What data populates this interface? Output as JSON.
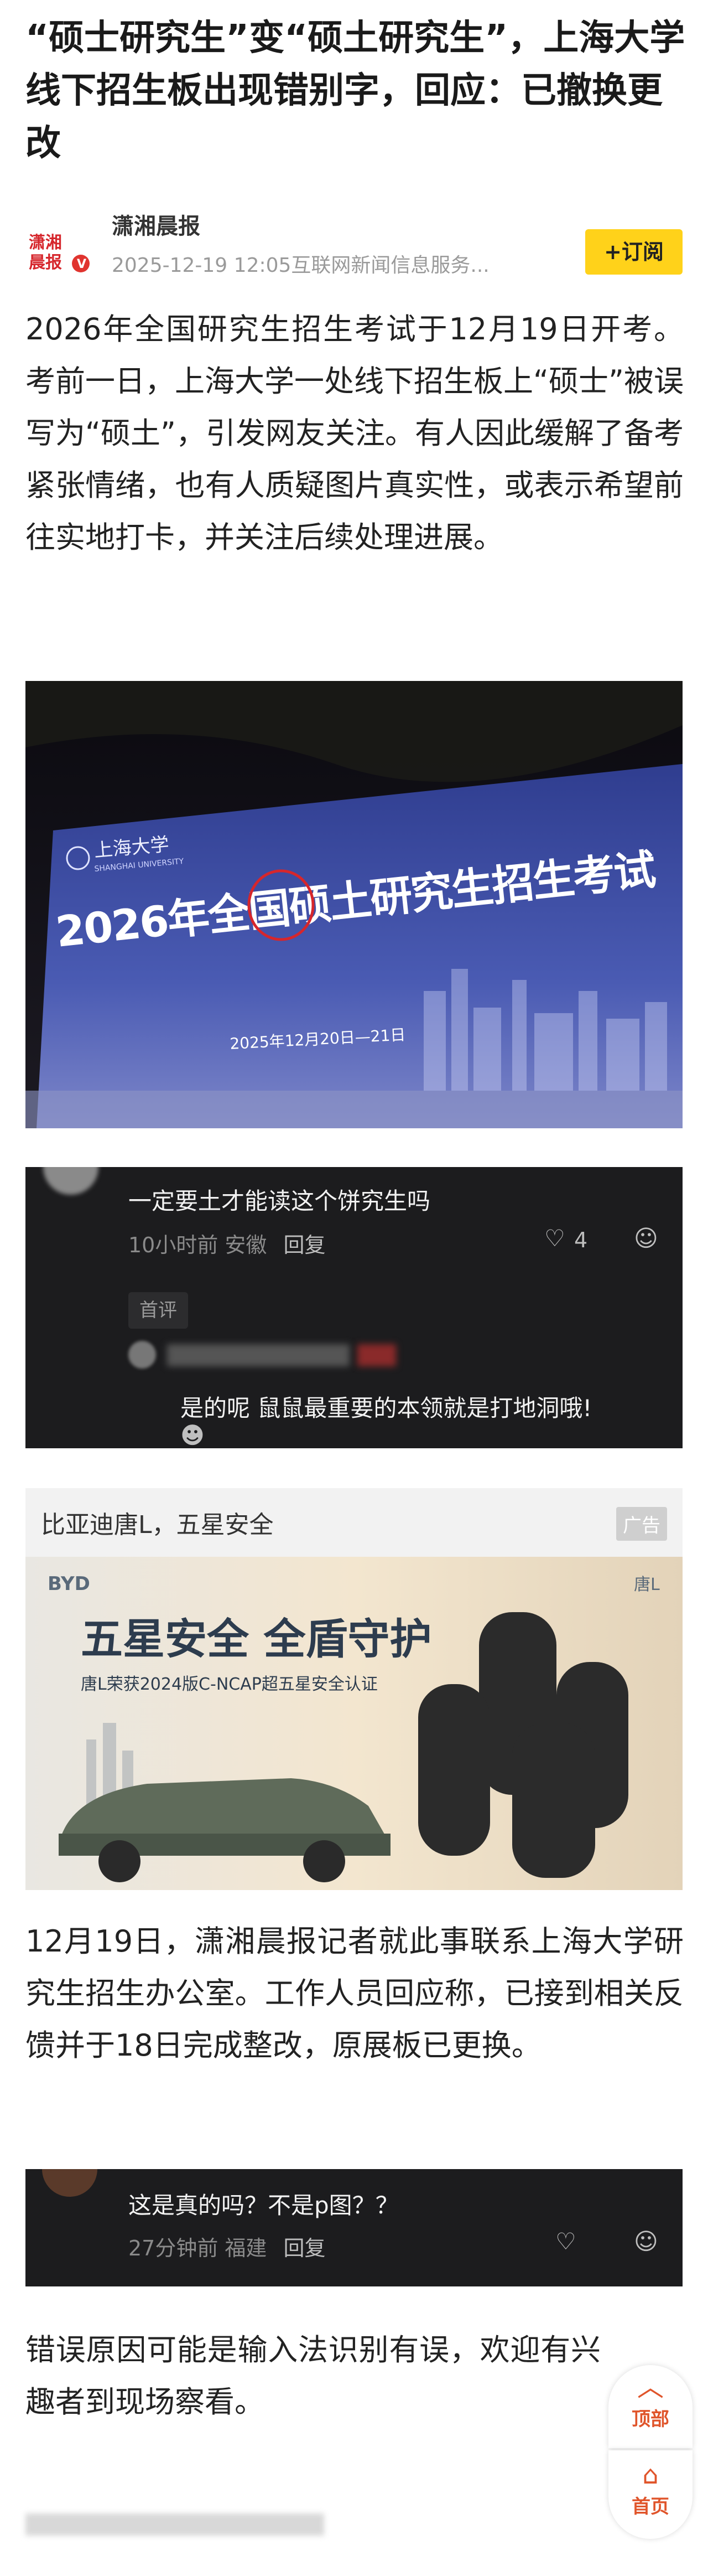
{
  "article": {
    "title": "“硕士研究生”变“硕土研究生”，上海大学线下招生板出现错别字，回应：已撤换更改",
    "author": {
      "name": "潇湘晨报",
      "logo_text_1": "潇湘",
      "logo_text_2": "晨报",
      "verified": "V",
      "meta": "2025-12-19 12:05互联网新闻信息服务..."
    },
    "subscribe_label": "+订阅",
    "paragraphs": [
      "2026年全国研究生招生考试于12月19日开考。考前一日，上海大学一处线下招生板上“硕士”被误写为“硕土”，引发网友关注。有人因此缓解了备考紧张情绪，也有人质疑图片真实性，或表示希望前往实地打卡，并关注后续处理进展。",
      "12月19日，潇湘晨报记者就此事联系上海大学研究生招生办公室。工作人员回应称，已接到相关反馈并于18日完成整改，原展板已更换。",
      "错误原因可能是输入法识别有误，欢迎有兴趣者到现场察看。"
    ]
  },
  "photo": {
    "school": "上海大学",
    "school_en": "SHANGHAI UNIVERSITY",
    "banner": "2026年全国硕土研究生招生考试",
    "dates": "2025年12月20日—21日"
  },
  "comments1": {
    "c1_text": "一定要土才能读这个饼究生吗",
    "c1_time": "10小时前 安徽",
    "reply": "回复",
    "c1_likes": "4",
    "first_tag": "首评",
    "c2_text": "是的呢 鼠鼠最重要的本领就是打地洞哦!"
  },
  "ad": {
    "title": "比亚迪唐L，五星安全",
    "badge": "广告",
    "brand": "BYD",
    "model": "唐L",
    "headline": "五星安全 全盾守护",
    "sub": "唐L荣获2024版C-NCAP超五星安全认证"
  },
  "comments2": {
    "text": "这是真的吗？不是p图？？",
    "time": "27分钟前 福建",
    "reply": "回复"
  },
  "float": {
    "top_label": "顶部",
    "home_label": "首页"
  },
  "colors": {
    "accent": "#ffd21a",
    "float_accent": "#e0552b",
    "logo_red": "#d6262c"
  }
}
